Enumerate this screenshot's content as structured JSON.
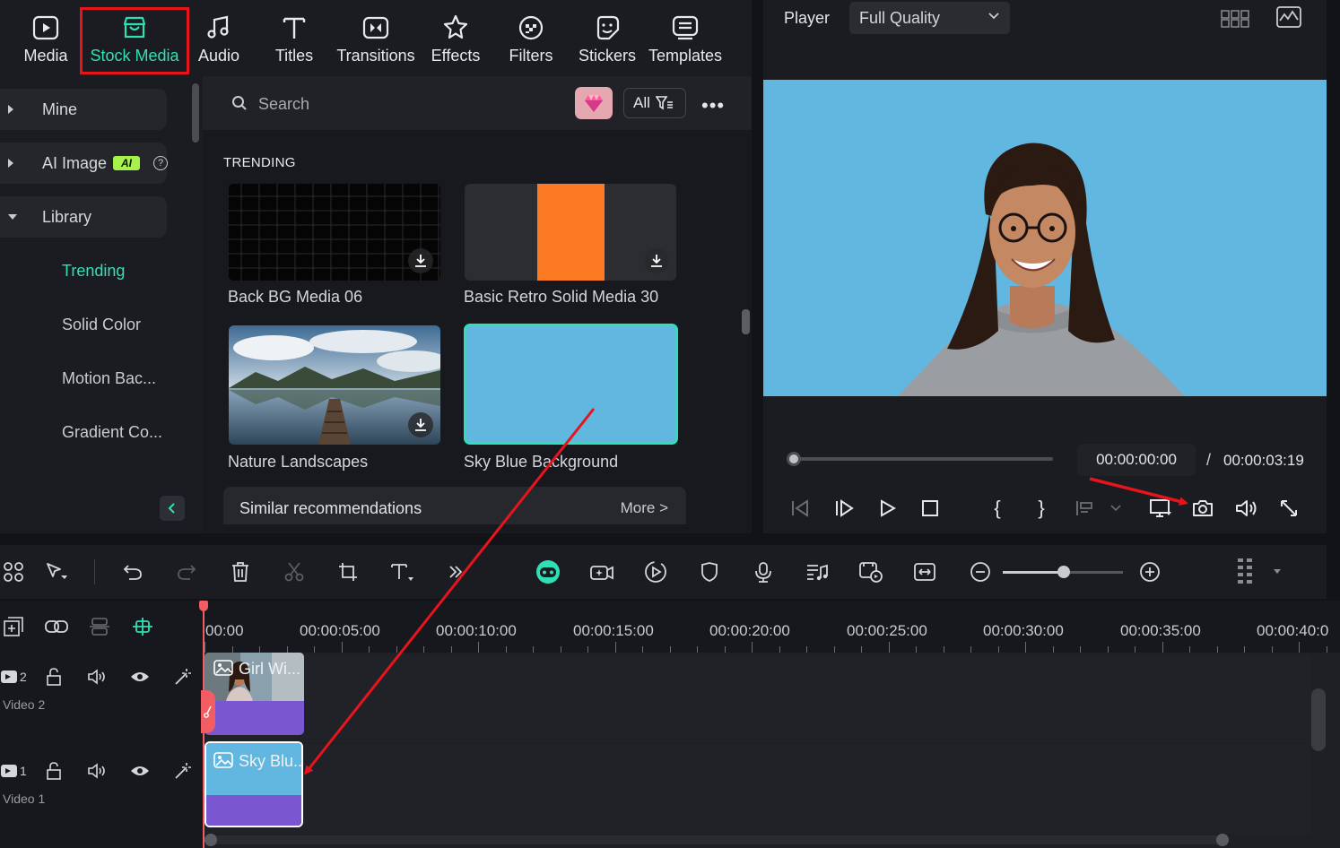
{
  "toolbar": {
    "tabs": [
      {
        "label": "Media",
        "icon": "media-icon"
      },
      {
        "label": "Stock Media",
        "icon": "stock-media-icon"
      },
      {
        "label": "Audio",
        "icon": "music-note-icon"
      },
      {
        "label": "Titles",
        "icon": "title-t-icon"
      },
      {
        "label": "Transitions",
        "icon": "transitions-icon"
      },
      {
        "label": "Effects",
        "icon": "effects-icon"
      },
      {
        "label": "Filters",
        "icon": "filters-icon"
      },
      {
        "label": "Stickers",
        "icon": "stickers-icon"
      },
      {
        "label": "Templates",
        "icon": "templates-icon"
      }
    ],
    "active": "Stock Media"
  },
  "sidebar": {
    "mine": "Mine",
    "ai_image": "AI Image",
    "ai_badge": "AI",
    "library": "Library",
    "sub_items": [
      "Trending",
      "Solid Color",
      "Motion Bac...",
      "Gradient Co..."
    ]
  },
  "browser": {
    "search_placeholder": "Search",
    "filter_label": "All",
    "section": "TRENDING",
    "items": [
      {
        "caption": "Back BG Media 06"
      },
      {
        "caption": "Basic Retro Solid Media 30"
      },
      {
        "caption": "Nature Landscapes"
      },
      {
        "caption": "Sky Blue Background"
      }
    ],
    "similar": "Similar recommendations",
    "more": "More >"
  },
  "player": {
    "label": "Player",
    "quality": "Full Quality",
    "current_time": "00:00:00:00",
    "separator": "/",
    "total_time": "00:00:03:19",
    "progress_fraction": 0.0
  },
  "timeline": {
    "ruler": [
      "00:00",
      "00:00:05:00",
      "00:00:10:00",
      "00:00:15:00",
      "00:00:20:00",
      "00:00:25:00",
      "00:00:30:00",
      "00:00:35:00",
      "00:00:40:0"
    ],
    "tracks": [
      {
        "number": "2",
        "label": "Video 2",
        "clip": "Girl Wi..."
      },
      {
        "number": "1",
        "label": "Video 1",
        "clip": "Sky Blu..."
      }
    ]
  },
  "colors": {
    "accent": "#2fe0b5",
    "highlight": "#e8141c",
    "sky_blue": "#62b7e1",
    "clip_purple": "#7a57d1",
    "playhead": "#f25c63"
  }
}
